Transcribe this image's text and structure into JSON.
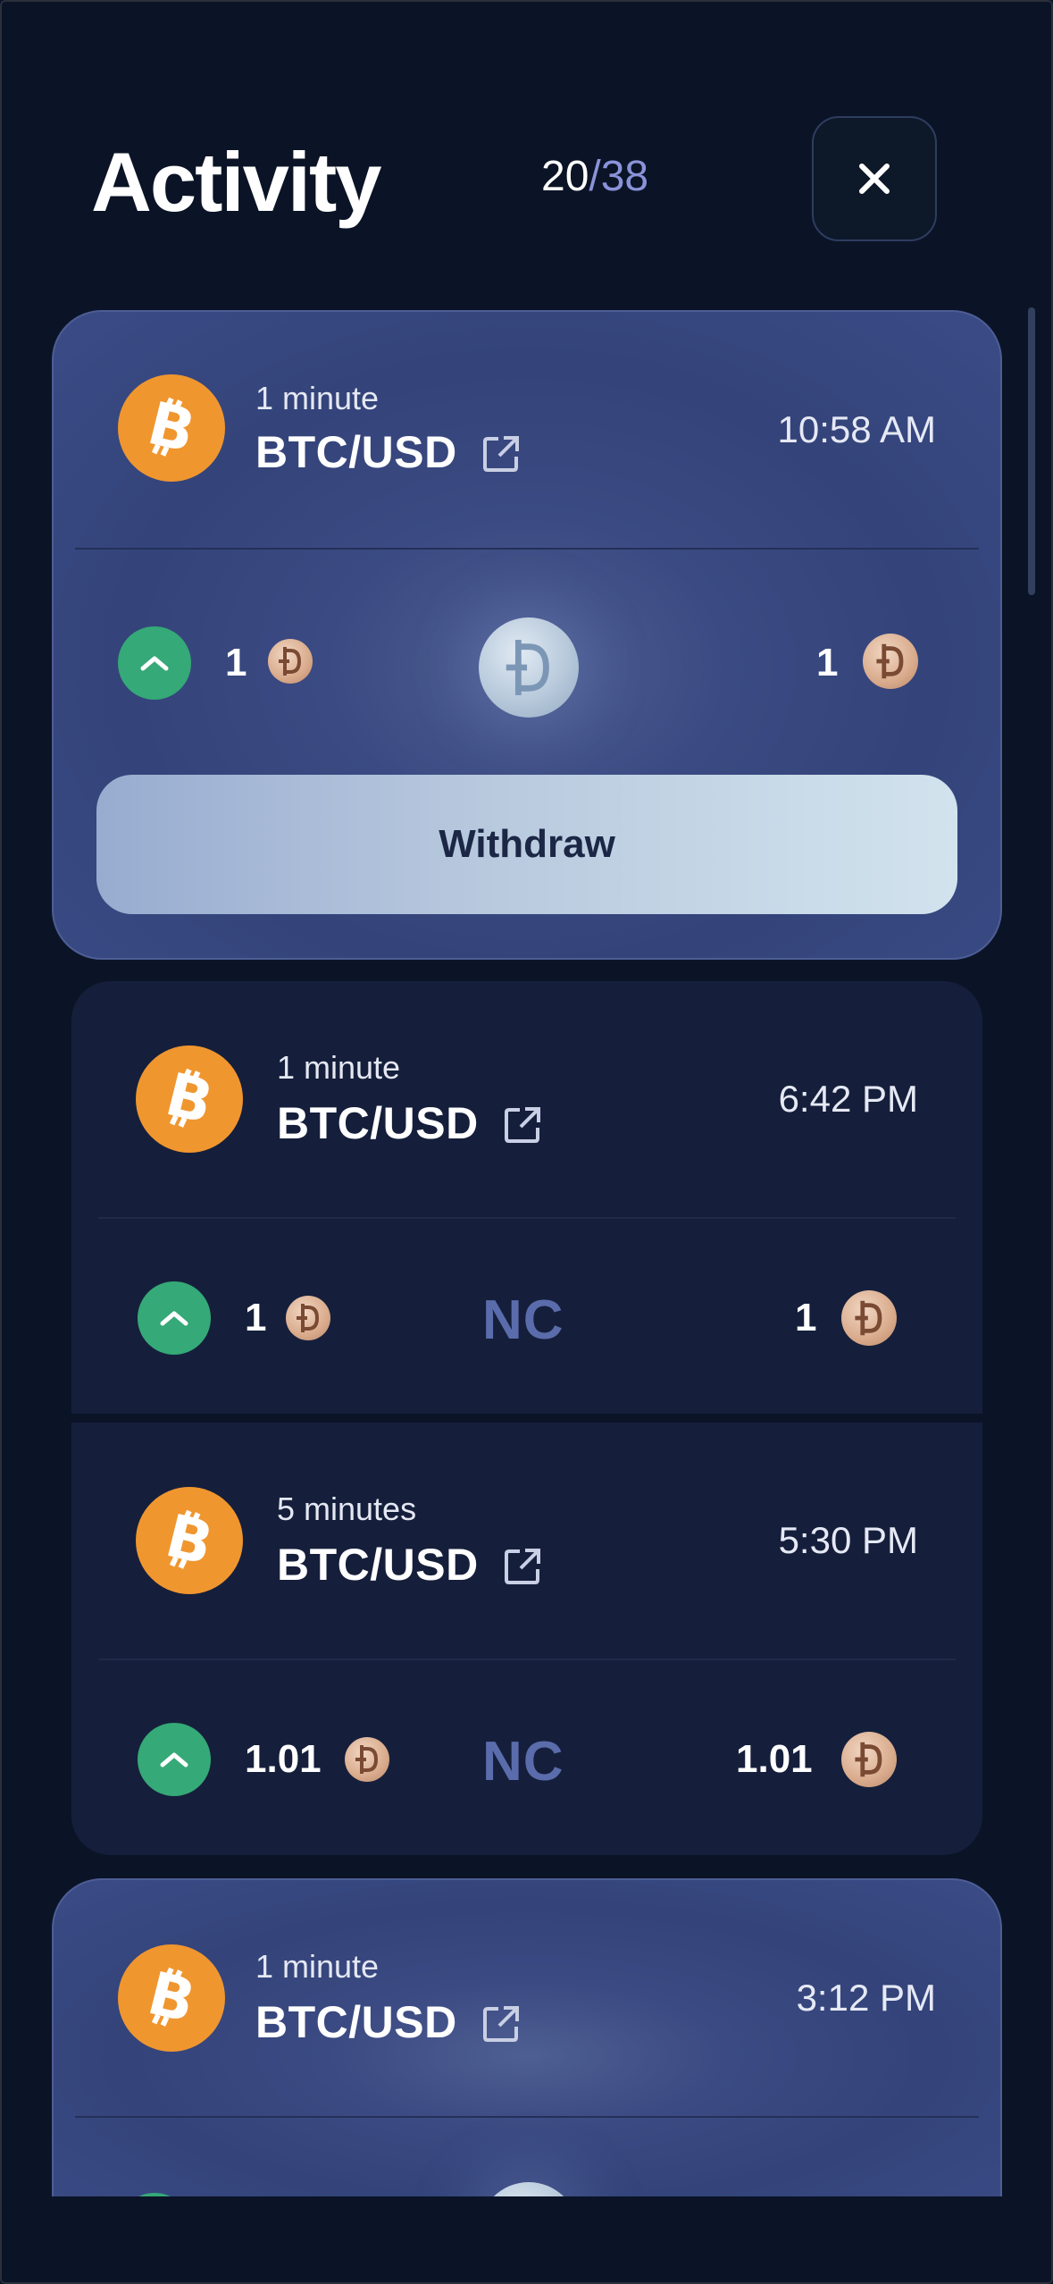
{
  "header": {
    "title": "Activity",
    "counter_current": "20",
    "counter_sep": "/",
    "counter_total": "38"
  },
  "cards": [
    {
      "duration": "1 minute",
      "pair": "BTC/USD",
      "time": "10:58 AM",
      "direction": "up",
      "amount_left": "1",
      "amount_right": "1",
      "center": "coin",
      "action_label": "Withdraw"
    },
    {
      "duration": "1 minute",
      "pair": "BTC/USD",
      "time": "6:42 PM",
      "direction": "up",
      "amount_left": "1",
      "amount_right": "1",
      "center": "NC"
    },
    {
      "duration": "5 minutes",
      "pair": "BTC/USD",
      "time": "5:30 PM",
      "direction": "up",
      "amount_left": "1.01",
      "amount_right": "1.01",
      "center": "NC"
    },
    {
      "duration": "1 minute",
      "pair": "BTC/USD",
      "time": "3:12 PM",
      "direction": "up",
      "center": "coin"
    }
  ],
  "colors": {
    "background": "#0b1426",
    "active_card": "#3b4a82",
    "plain_card": "#151f3b",
    "btc_orange": "#f0962f",
    "up_green": "#35a977",
    "nc_text": "#5a6cab"
  }
}
